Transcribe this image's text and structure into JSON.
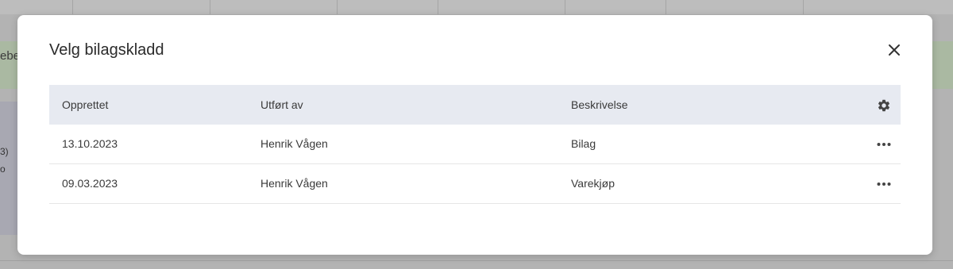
{
  "background": {
    "band_text": "ebe",
    "left_text_1": "3)",
    "left_text_2": "o"
  },
  "modal": {
    "title": "Velg bilagskladd",
    "close_icon": "close-icon",
    "table": {
      "columns": [
        "Opprettet",
        "Utført av",
        "Beskrivelse"
      ],
      "settings_icon": "gear-icon",
      "rows": [
        {
          "opprettet": "13.10.2023",
          "utfort_av": "Henrik Vågen",
          "beskrivelse": "Bilag",
          "menu_icon": "more-icon"
        },
        {
          "opprettet": "09.03.2023",
          "utfort_av": "Henrik Vågen",
          "beskrivelse": "Varekjøp",
          "menu_icon": "more-icon"
        }
      ]
    }
  },
  "colors": {
    "overlay": "#b3b3b3",
    "header_bg": "#e7eaf1",
    "text": "#3a3a3a",
    "icon": "#444444"
  }
}
